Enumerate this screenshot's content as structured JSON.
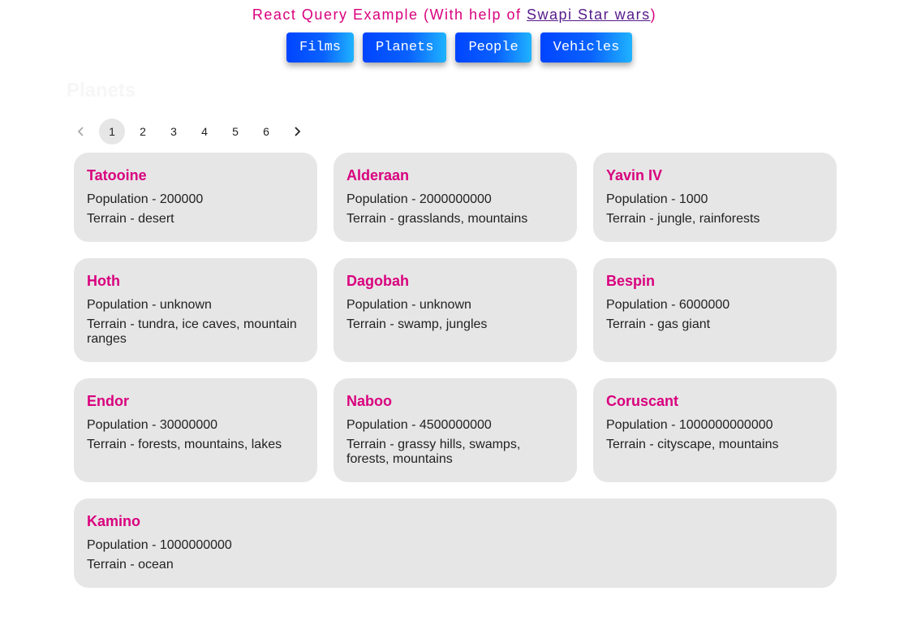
{
  "header": {
    "prefix": "React Query Example (With help of ",
    "link_text": "Swapi Star wars",
    "suffix": ")"
  },
  "nav": {
    "films": "Films",
    "planets": "Planets",
    "people": "People",
    "vehicles": "Vehicles"
  },
  "section_title": "Planets",
  "pagination": {
    "pages": [
      "1",
      "2",
      "3",
      "4",
      "5",
      "6"
    ],
    "current": "1"
  },
  "labels": {
    "population": "Population - ",
    "terrain": "Terrain - "
  },
  "planets": [
    {
      "name": "Tatooine",
      "population": "200000",
      "terrain": "desert"
    },
    {
      "name": "Alderaan",
      "population": "2000000000",
      "terrain": "grasslands, mountains"
    },
    {
      "name": "Yavin IV",
      "population": "1000",
      "terrain": "jungle, rainforests"
    },
    {
      "name": "Hoth",
      "population": "unknown",
      "terrain": "tundra, ice caves, mountain ranges"
    },
    {
      "name": "Dagobah",
      "population": "unknown",
      "terrain": "swamp, jungles"
    },
    {
      "name": "Bespin",
      "population": "6000000",
      "terrain": "gas giant"
    },
    {
      "name": "Endor",
      "population": "30000000",
      "terrain": "forests, mountains, lakes"
    },
    {
      "name": "Naboo",
      "population": "4500000000",
      "terrain": "grassy hills, swamps, forests, mountains"
    },
    {
      "name": "Coruscant",
      "population": "1000000000000",
      "terrain": "cityscape, mountains"
    },
    {
      "name": "Kamino",
      "population": "1000000000",
      "terrain": "ocean"
    }
  ],
  "colors": {
    "accent": "#d9007e",
    "link": "#551a8b",
    "card_bg": "#e6e6e6",
    "button_start": "#0044ff",
    "button_end": "#1fb3ff"
  }
}
